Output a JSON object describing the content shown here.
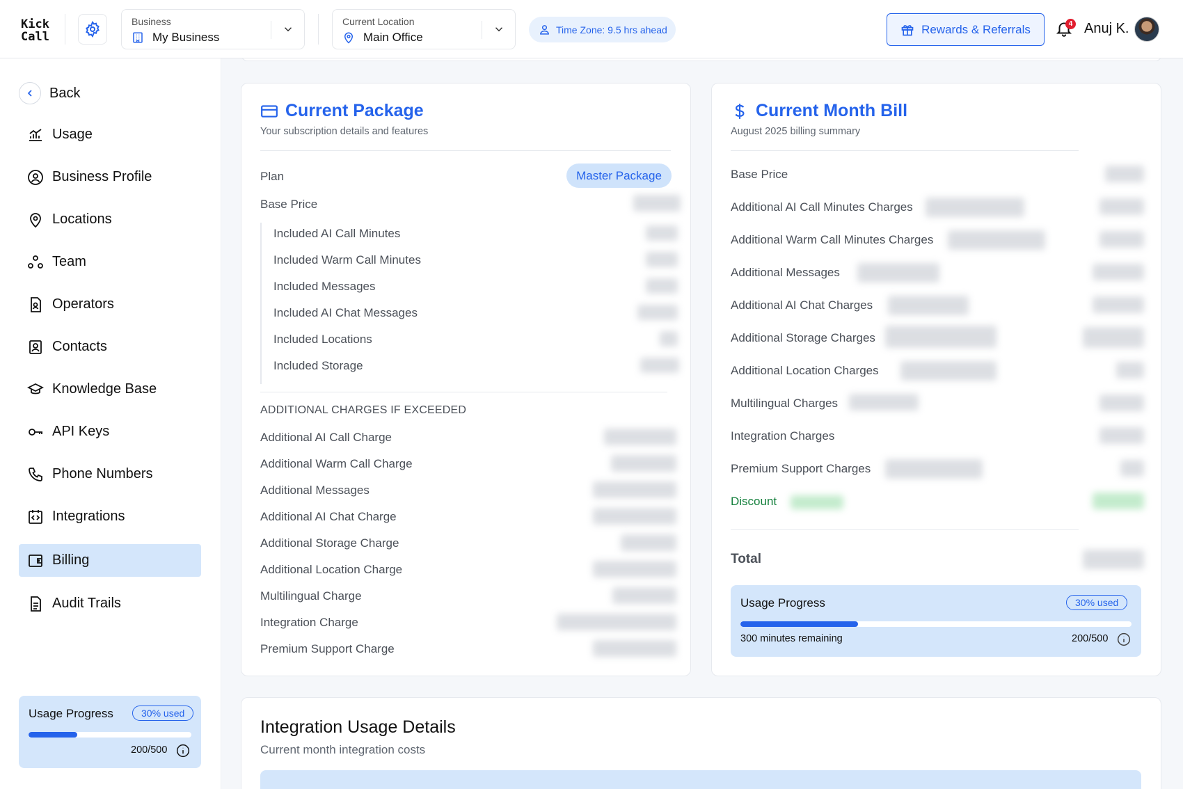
{
  "header": {
    "logo_line1": "Kick",
    "logo_line2": "Call",
    "business_label": "Business",
    "business_value": "My Business",
    "location_label": "Current Location",
    "location_value": "Main Office",
    "timezone": "Time Zone: 9.5 hrs ahead",
    "rewards_label": "Rewards & Referrals",
    "notification_count": "4",
    "user_name": "Anuj K."
  },
  "sidebar": {
    "back_label": "Back",
    "items": [
      {
        "label": "Usage",
        "icon": "chart-line-icon"
      },
      {
        "label": "Business Profile",
        "icon": "user-circle-icon"
      },
      {
        "label": "Locations",
        "icon": "map-pin-icon"
      },
      {
        "label": "Team",
        "icon": "team-icon"
      },
      {
        "label": "Operators",
        "icon": "id-document-icon"
      },
      {
        "label": "Contacts",
        "icon": "contact-card-icon"
      },
      {
        "label": "Knowledge Base",
        "icon": "graduation-cap-icon"
      },
      {
        "label": "API Keys",
        "icon": "key-icon"
      },
      {
        "label": "Phone Numbers",
        "icon": "phone-icon"
      },
      {
        "label": "Integrations",
        "icon": "code-box-icon"
      },
      {
        "label": "Billing",
        "icon": "wallet-icon",
        "active": true
      },
      {
        "label": "Audit Trails",
        "icon": "file-text-icon"
      }
    ],
    "usage": {
      "title": "Usage Progress",
      "pill": "30% used",
      "progress_fraction": 0.3,
      "count": "200/500"
    }
  },
  "package": {
    "title": "Current Package",
    "subtitle": "Your subscription details and features",
    "plan_label": "Plan",
    "plan_value": "Master Package",
    "base_price_label": "Base Price",
    "included": [
      "Included AI Call Minutes",
      "Included Warm Call Minutes",
      "Included Messages",
      "Included AI Chat Messages",
      "Included Locations",
      "Included Storage"
    ],
    "additional_heading": "ADDITIONAL CHARGES IF EXCEEDED",
    "additional": [
      "Additional AI Call Charge",
      "Additional Warm Call Charge",
      "Additional Messages",
      "Additional AI Chat Charge",
      "Additional Storage Charge",
      "Additional Location Charge",
      "Multilingual Charge",
      "Integration Charge",
      "Premium Support Charge"
    ]
  },
  "bill": {
    "title": "Current Month Bill",
    "subtitle": "August 2025 billing summary",
    "rows": [
      "Base Price",
      "Additional AI Call Minutes Charges",
      "Additional Warm Call Minutes Charges",
      "Additional Messages",
      "Additional AI Chat Charges",
      "Additional Storage Charges",
      "Additional Location Charges",
      "Multilingual Charges",
      "Integration Charges",
      "Premium Support Charges"
    ],
    "discount_label": "Discount",
    "total_label": "Total",
    "usage": {
      "title": "Usage Progress",
      "pill": "30% used",
      "progress_fraction": 0.3,
      "remaining": "300 minutes remaining",
      "count": "200/500"
    }
  },
  "integration_usage": {
    "title": "Integration Usage Details",
    "subtitle": "Current month integration costs"
  },
  "colors": {
    "accent": "#2563eb",
    "active_bg": "#d4e6fb",
    "discount": "#15803d",
    "badge": "#e11d2e"
  }
}
